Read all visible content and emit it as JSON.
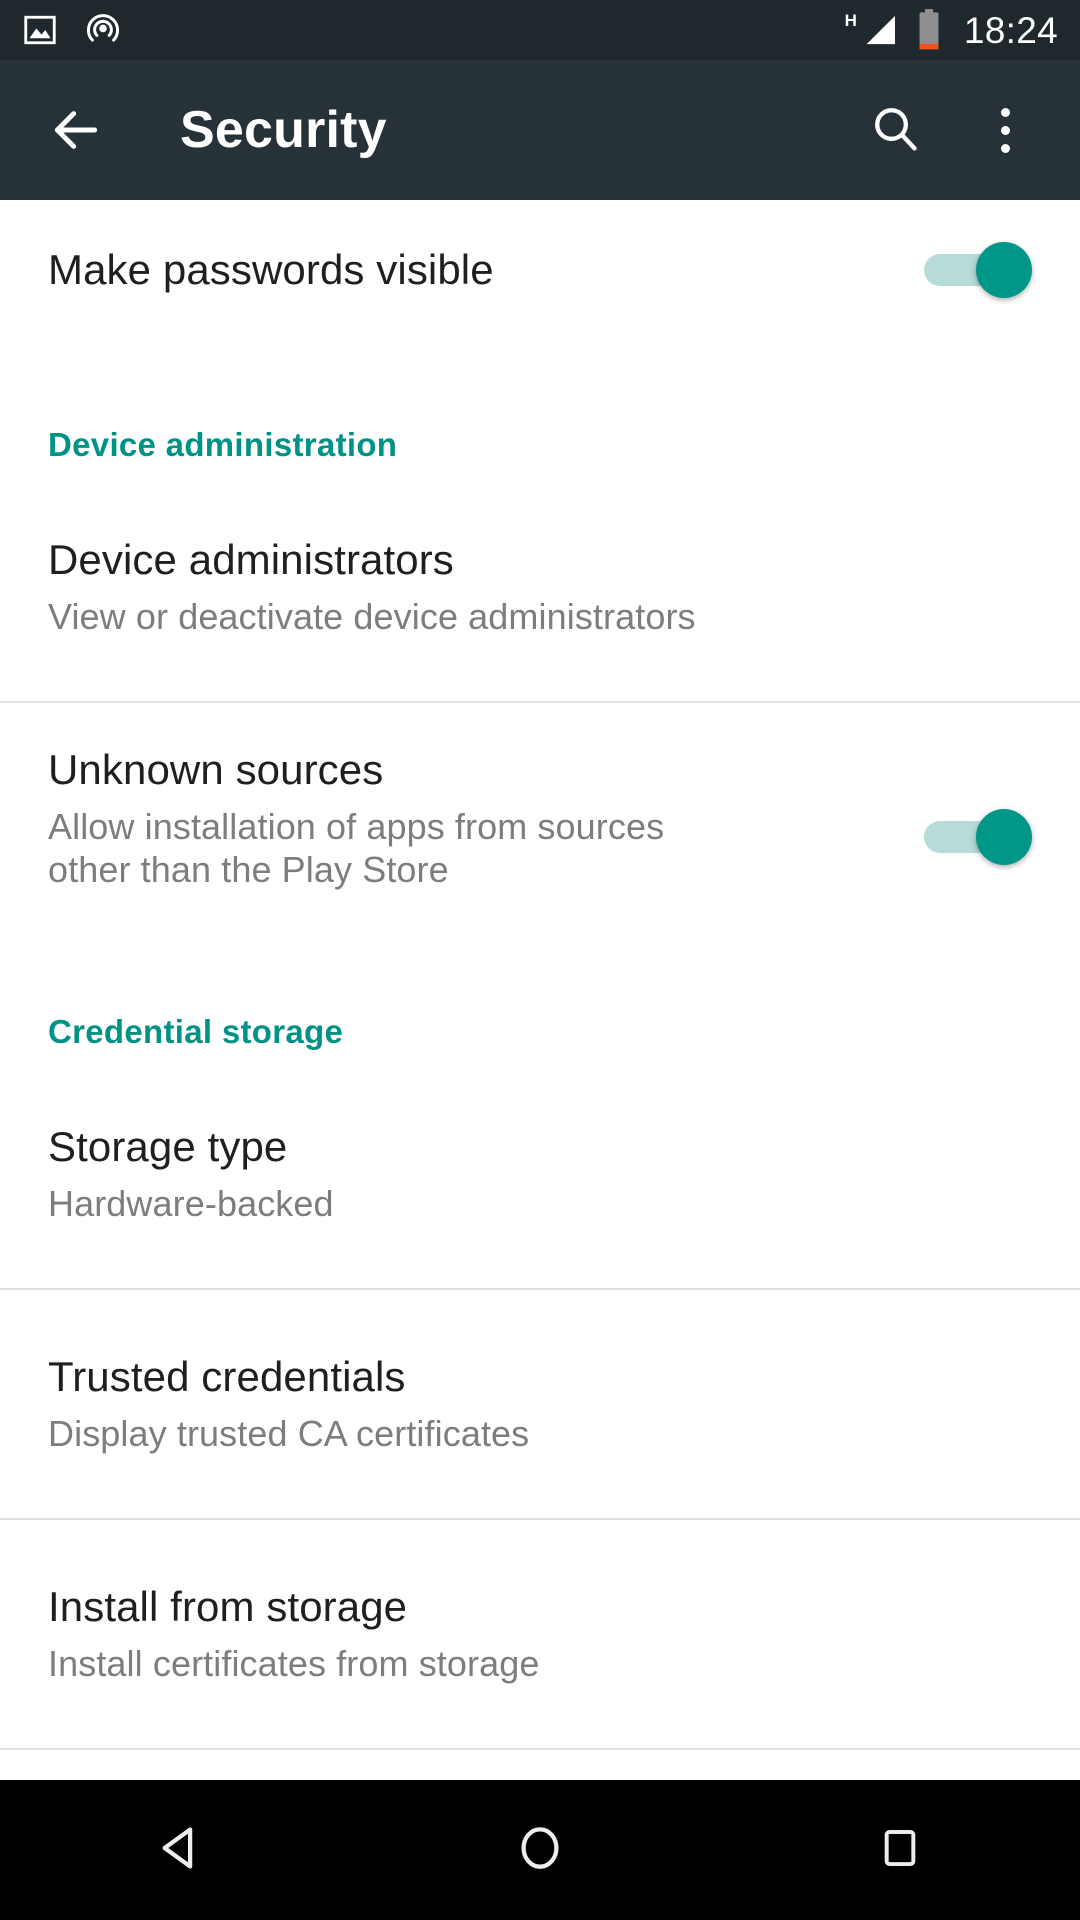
{
  "status_bar": {
    "left_icons": [
      {
        "name": "screenshot-image-icon",
        "label": "Screenshot"
      },
      {
        "name": "cast-broadcast-icon",
        "label": "Cast"
      }
    ],
    "network_type": "H",
    "signal_icon": "signal-triangle-icon",
    "battery_icon": "battery-low-icon",
    "time": "18:24"
  },
  "app_bar": {
    "back_icon": "arrow-left-icon",
    "title": "Security",
    "search_icon": "search-icon",
    "overflow_icon": "more-vertical-icon"
  },
  "colors": {
    "accent_teal": "#009688",
    "section_header_teal": "#009385",
    "app_bar": "#263238",
    "status_bar": "#1f282c",
    "nav_bar": "#000000",
    "title_text": "#1f1f1f",
    "subtitle_text": "#7d7d7d",
    "divider": "#e2e2e2",
    "switch_track_on": "#b6dcd7",
    "battery_low": "#f4511e"
  },
  "settings": {
    "make_passwords_visible": {
      "title": "Make passwords visible",
      "toggle_state": "on"
    },
    "device_administration_header": "Device administration",
    "device_administrators": {
      "title": "Device administrators",
      "subtitle": "View or deactivate device administrators"
    },
    "unknown_sources": {
      "title": "Unknown sources",
      "subtitle": "Allow installation of apps from sources other than the Play Store",
      "toggle_state": "on"
    },
    "credential_storage_header": "Credential storage",
    "storage_type": {
      "title": "Storage type",
      "subtitle": "Hardware-backed"
    },
    "trusted_credentials": {
      "title": "Trusted credentials",
      "subtitle": "Display trusted CA certificates"
    },
    "install_from_storage": {
      "title": "Install from storage",
      "subtitle": "Install certificates from storage"
    }
  },
  "nav_bar": {
    "back": "back-triangle-icon",
    "home": "home-circle-icon",
    "recents": "recents-square-icon"
  }
}
